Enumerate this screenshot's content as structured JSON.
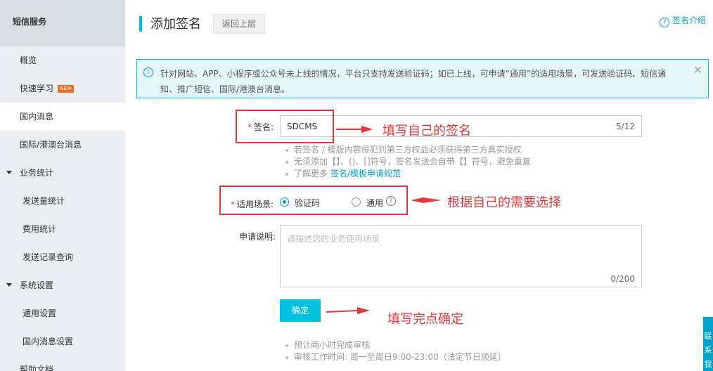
{
  "sidebar": {
    "title": "短信服务",
    "items": [
      {
        "label": "概览"
      },
      {
        "label": "快速学习",
        "badge": "NEW"
      },
      {
        "label": "国内消息"
      },
      {
        "label": "国际/港澳台消息"
      },
      {
        "label": "业务统计"
      },
      {
        "label": "发送量统计"
      },
      {
        "label": "费用统计"
      },
      {
        "label": "发送记录查询"
      },
      {
        "label": "系统设置"
      },
      {
        "label": "通用设置"
      },
      {
        "label": "国内消息设置"
      },
      {
        "label": "帮助文档"
      }
    ]
  },
  "header": {
    "title": "添加签名",
    "back_label": "返回上层",
    "help_label": "签名介绍"
  },
  "notice": {
    "text": "针对网站、APP、小程序或公众号未上线的情况，平台只支持发送验证码；如已上线，可申请“通用”的适用场景，可发送验证码、短信通知、推广短信、国际/港澳台消息。"
  },
  "form": {
    "required_mark": "*",
    "signature_label": "签名:",
    "signature_value": "SDCMS",
    "signature_count": "5/12",
    "hints": [
      "若签名 / 模版内容侵犯到第三方权益必须获得第三方真实授权",
      "无须添加【】、()、[]符号，签名发送会自带【】符号，避免重复"
    ],
    "hint_more_prefix": "了解更多",
    "hint_more_link": "签名/模板申请规范",
    "scene_label": "适用场景:",
    "scene_options": [
      "验证码",
      "通用"
    ],
    "scene_selected": "验证码",
    "desc_label": "申请说明:",
    "desc_placeholder": "请描述您的业务使用场景",
    "desc_count": "0/200",
    "confirm_label": "确定",
    "bottom_hints": [
      "预计两小时完成审核",
      "审核工作时间: 周一至周日9:00-23:00（法定节日顺延）"
    ]
  },
  "annotations": {
    "a1": "填写自己的签名",
    "a2": "根据自己的需要选择",
    "a3": "填写完点确定"
  },
  "side_tab": "联系我们"
}
